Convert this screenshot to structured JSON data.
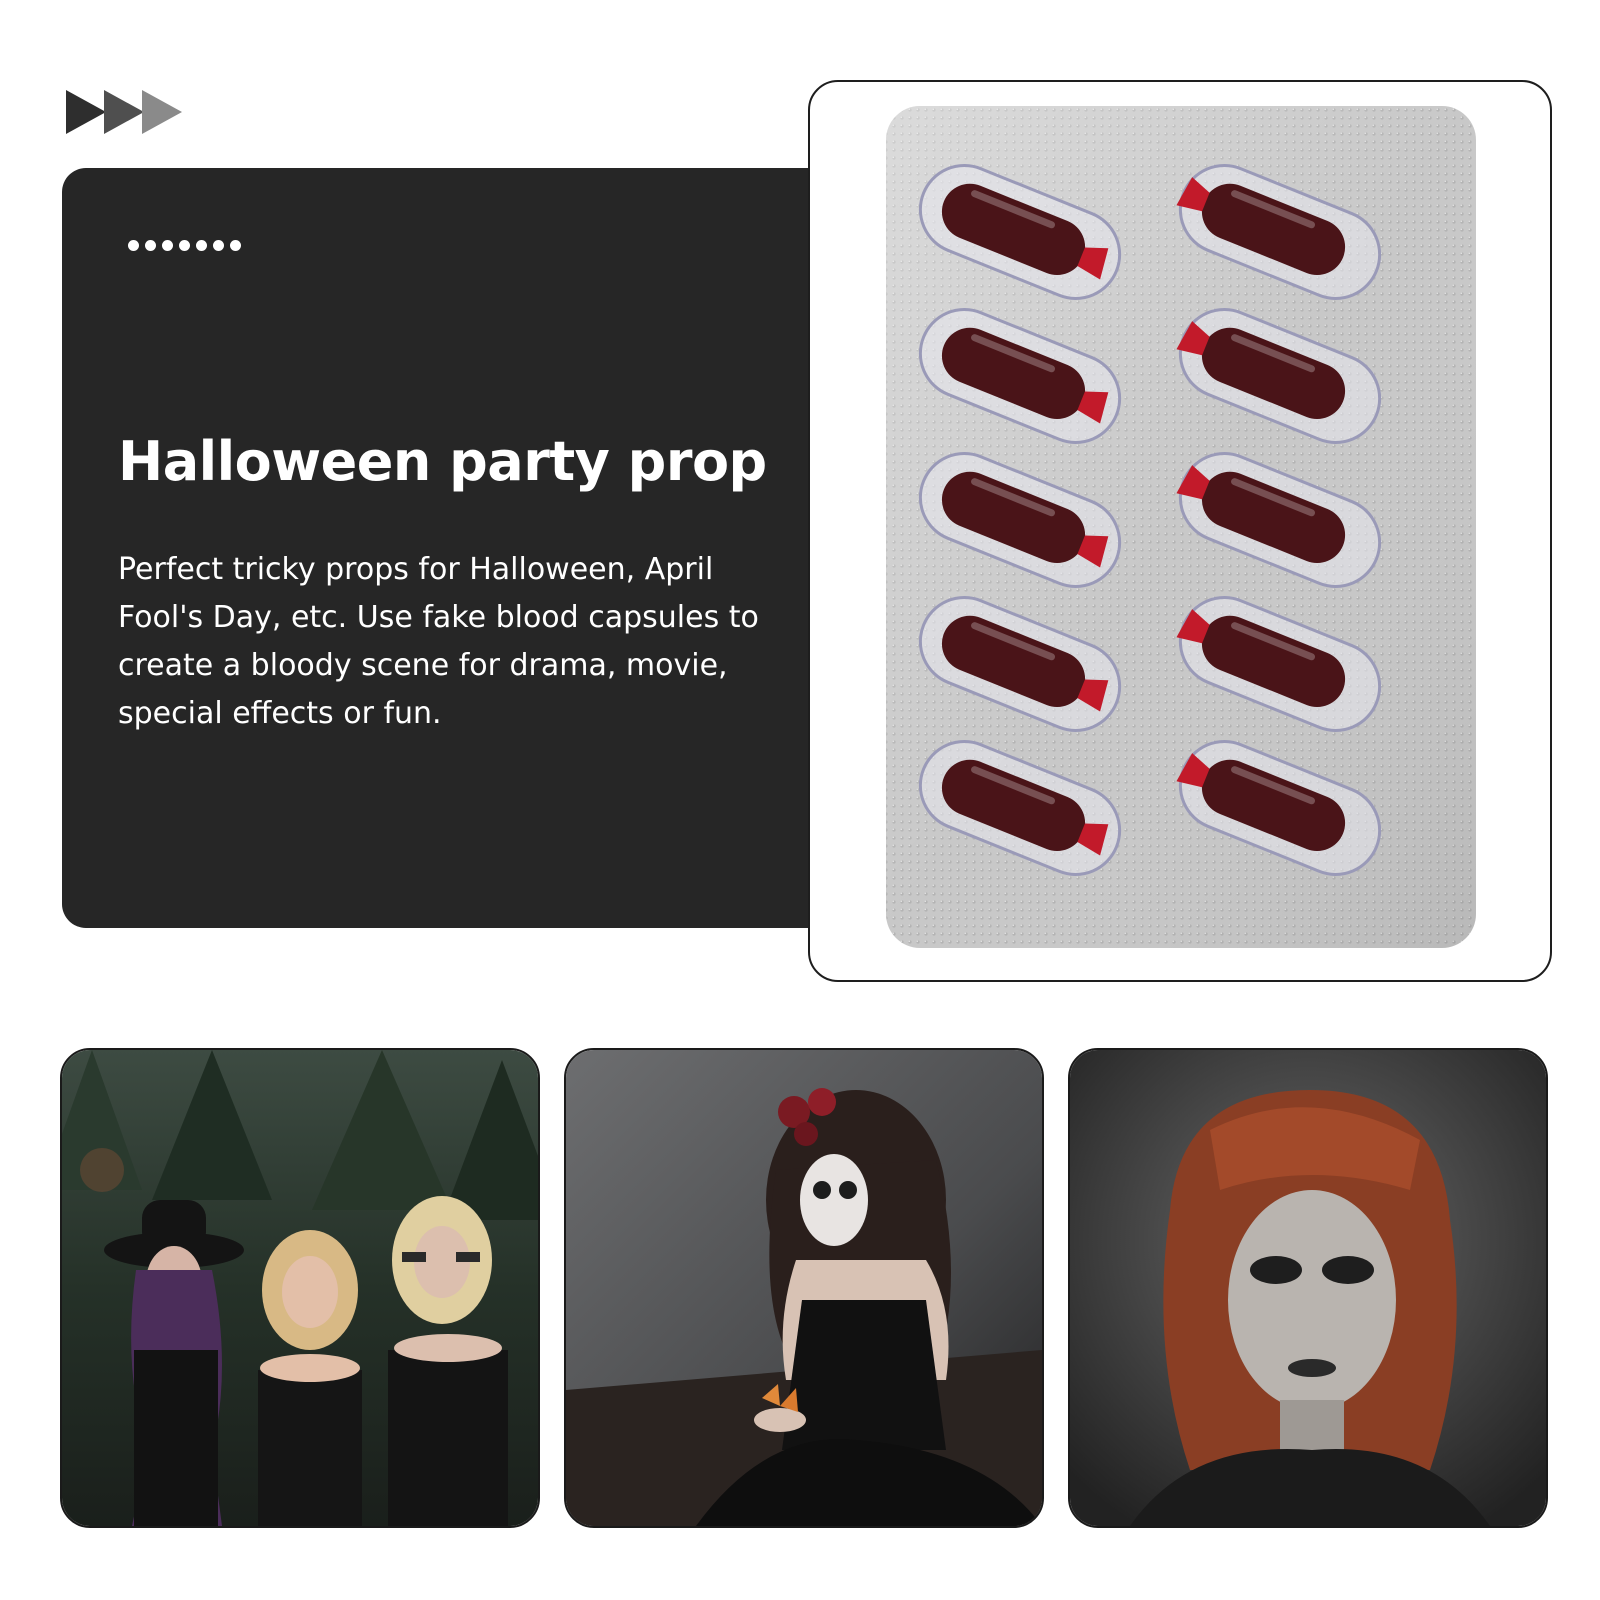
{
  "headline": "Halloween party prop",
  "description": "Perfect tricky props for Halloween, April Fool's Day, etc. Use fake blood capsules to create a bloody scene for drama, movie, special effects or fun.",
  "decorations": {
    "arrow_icon": "triple-play-arrows",
    "dots_count": 7
  },
  "colors": {
    "panel_bg": "#262626",
    "text": "#ffffff",
    "arrow_dark": "#2e2e2e",
    "arrow_mid": "#4f4f4f",
    "arrow_light": "#8a8a8a",
    "blister_foil": "#c9c9c9",
    "capsule_blood": "#4a1418",
    "capsule_tip": "#c21a2a"
  },
  "product_image": {
    "subject": "blister pack of fake blood capsules",
    "capsule_count": 10
  },
  "lifestyle_photos": [
    {
      "subject": "three women in gothic witch costumes outdoors"
    },
    {
      "subject": "woman with sugar-skull makeup and butterfly"
    },
    {
      "subject": "red-haired woman with dark gothic makeup"
    }
  ]
}
